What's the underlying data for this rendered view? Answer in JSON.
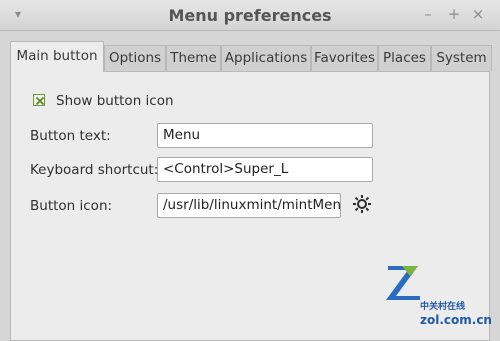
{
  "window": {
    "title": "Menu preferences"
  },
  "tabs": [
    {
      "label": "Main button",
      "active": true
    },
    {
      "label": "Options"
    },
    {
      "label": "Theme"
    },
    {
      "label": "Applications"
    },
    {
      "label": "Favorites"
    },
    {
      "label": "Places"
    },
    {
      "label": "System"
    }
  ],
  "main": {
    "show_icon": {
      "label": "Show button icon",
      "checked": true
    },
    "button_text": {
      "label": "Button text:",
      "value": "Menu"
    },
    "shortcut": {
      "label": "Keyboard shortcut:",
      "value": "<Control>Super_L"
    },
    "button_icon": {
      "label": "Button icon:",
      "value": "/usr/lib/linuxmint/mintMenu"
    }
  },
  "watermark": {
    "line1": "中关村在线",
    "line2": "zol.com.cn"
  }
}
